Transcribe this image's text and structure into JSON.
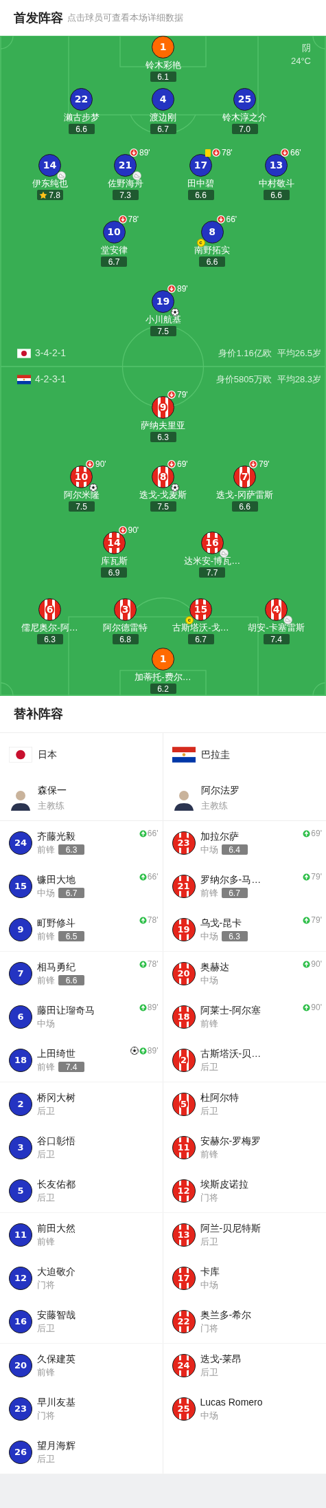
{
  "lineup": {
    "title": "首发阵容",
    "hint": "点击球员可查看本场详细数据",
    "weather": "阴",
    "temperature": "24°C",
    "home": {
      "kind": "japan",
      "rows": [
        [
          {
            "number": "1",
            "name": "铃木彩艳",
            "rating": "6.1",
            "kind": "keeper",
            "yellow_card": false,
            "goal": false,
            "assist": false,
            "best": false
          }
        ],
        [
          {
            "number": "22",
            "name": "濑古步梦",
            "rating": "6.6",
            "kind": "outfield",
            "yellow_card": false,
            "goal": false,
            "assist": false,
            "best": false
          },
          {
            "number": "4",
            "name": "渡边刚",
            "rating": "6.7",
            "kind": "outfield",
            "yellow_card": false,
            "goal": false,
            "assist": false,
            "best": false
          },
          {
            "number": "25",
            "name": "铃木淳之介",
            "rating": "7.0",
            "kind": "outfield",
            "yellow_card": false,
            "goal": false,
            "assist": false,
            "best": false
          }
        ],
        [
          {
            "number": "14",
            "name": "伊东纯也",
            "rating": "7.8",
            "kind": "outfield",
            "yellow_card": false,
            "goal": false,
            "assist": true,
            "best": true
          },
          {
            "number": "21",
            "name": "佐野海舟",
            "rating": "7.3",
            "kind": "outfield",
            "sub_off": "89'",
            "yellow_card": false,
            "goal": false,
            "assist": true,
            "best": false
          },
          {
            "number": "17",
            "name": "田中碧",
            "rating": "6.6",
            "kind": "outfield",
            "sub_off": "78'",
            "yellow_card": true,
            "goal": false,
            "assist": false,
            "best": false
          },
          {
            "number": "13",
            "name": "中村敬斗",
            "rating": "6.6",
            "kind": "outfield",
            "sub_off": "66'",
            "yellow_card": false,
            "goal": false,
            "assist": false,
            "best": false
          }
        ],
        [
          {
            "number": "10",
            "name": "堂安律",
            "rating": "6.7",
            "kind": "outfield",
            "sub_off": "78'",
            "yellow_card": false,
            "goal": false,
            "assist": false,
            "best": false
          },
          {
            "number": "8",
            "name": "南野拓实",
            "rating": "6.6",
            "kind": "outfield",
            "sub_off": "66'",
            "captain_mark": "c",
            "yellow_card": false,
            "goal": false,
            "assist": false,
            "best": false
          }
        ],
        [
          {
            "number": "19",
            "name": "小川航基",
            "rating": "7.5",
            "kind": "outfield",
            "sub_off": "89'",
            "yellow_card": false,
            "goal": true,
            "assist": false,
            "best": false
          }
        ]
      ]
    },
    "team_stats": [
      {
        "kind": "japan",
        "formation": "3-4-2-1",
        "value": "身价1.16亿欧",
        "average_age": "平均26.5岁"
      },
      {
        "kind": "paraguay",
        "formation": "4-2-3-1",
        "value": "身价5805万欧",
        "average_age": "平均28.3岁"
      }
    ],
    "away": {
      "kind": "paraguay",
      "rows": [
        [
          {
            "number": "9",
            "name": "萨纳夫里亚",
            "rating": "6.3",
            "kind": "outfield",
            "sub_off": "79'",
            "yellow_card": false,
            "goal": false,
            "assist": false,
            "best": false
          }
        ],
        [
          {
            "number": "10",
            "name": "阿尔米隆",
            "rating": "7.5",
            "kind": "outfield",
            "sub_off": "90'",
            "yellow_card": false,
            "goal": true,
            "assist": false,
            "best": false
          },
          {
            "number": "8",
            "name": "迭戈-戈麦斯",
            "rating": "7.5",
            "kind": "outfield",
            "sub_off": "69'",
            "yellow_card": false,
            "goal": true,
            "assist": false,
            "best": false
          },
          {
            "number": "7",
            "name": "迭戈-冈萨雷斯",
            "rating": "6.6",
            "kind": "outfield",
            "sub_off": "79'",
            "yellow_card": false,
            "goal": false,
            "assist": false,
            "best": false
          }
        ],
        [
          {
            "number": "14",
            "name": "库瓦斯",
            "rating": "6.9",
            "kind": "outfield",
            "sub_off": "90'",
            "yellow_card": false,
            "goal": false,
            "assist": false,
            "best": false
          },
          {
            "number": "16",
            "name": "达米安-博瓦…",
            "rating": "7.7",
            "kind": "outfield",
            "yellow_card": false,
            "goal": false,
            "assist": true,
            "best": false
          }
        ],
        [
          {
            "number": "6",
            "name": "儒尼奥尔-阿…",
            "rating": "6.3",
            "kind": "outfield",
            "yellow_card": false,
            "goal": false,
            "assist": false,
            "best": false
          },
          {
            "number": "3",
            "name": "阿尔德雷特",
            "rating": "6.8",
            "kind": "outfield",
            "yellow_card": false,
            "goal": false,
            "assist": false,
            "best": false
          },
          {
            "number": "15",
            "name": "古斯塔沃-戈…",
            "rating": "6.7",
            "kind": "outfield",
            "captain_mark": "c",
            "yellow_card": false,
            "goal": false,
            "assist": false,
            "best": false
          },
          {
            "number": "4",
            "name": "胡安-卡塞雷斯",
            "rating": "7.4",
            "kind": "outfield",
            "yellow_card": false,
            "goal": false,
            "assist": true,
            "best": false
          }
        ],
        [
          {
            "number": "1",
            "name": "加蒂托-费尔…",
            "rating": "6.2",
            "kind": "keeper",
            "yellow_card": false,
            "goal": false,
            "assist": false,
            "best": false
          }
        ]
      ]
    }
  },
  "substitutes": {
    "title": "替补阵容",
    "teams": [
      {
        "kind": "japan",
        "name": "日本",
        "coach": {
          "name": "森保一",
          "role": "主教练"
        },
        "players": [
          {
            "number": "24",
            "name": "齐藤光毅",
            "position": "前锋",
            "rating": "6.3",
            "sub_on": "66'",
            "goal": false
          },
          {
            "number": "15",
            "name": "镰田大地",
            "position": "中场",
            "rating": "6.7",
            "sub_on": "66'",
            "goal": false
          },
          {
            "number": "9",
            "name": "町野修斗",
            "position": "前锋",
            "rating": "6.5",
            "sub_on": "78'",
            "goal": false
          },
          {
            "number": "7",
            "name": "相马勇纪",
            "position": "前锋",
            "rating": "6.6",
            "sub_on": "78'",
            "goal": false
          },
          {
            "number": "6",
            "name": "藤田让瑠奇马",
            "position": "中场",
            "sub_on": "89'",
            "goal": false
          },
          {
            "number": "18",
            "name": "上田绮世",
            "position": "前锋",
            "rating": "7.4",
            "sub_on": "89'",
            "goal": true
          },
          {
            "number": "2",
            "name": "桥冈大树",
            "position": "后卫",
            "goal": false
          },
          {
            "number": "3",
            "name": "谷口彰悟",
            "position": "后卫",
            "goal": false
          },
          {
            "number": "5",
            "name": "长友佑都",
            "position": "后卫",
            "goal": false
          },
          {
            "number": "11",
            "name": "前田大然",
            "position": "前锋",
            "goal": false
          },
          {
            "number": "12",
            "name": "大迫敬介",
            "position": "门将",
            "goal": false
          },
          {
            "number": "16",
            "name": "安藤智哉",
            "position": "后卫",
            "goal": false
          },
          {
            "number": "20",
            "name": "久保建英",
            "position": "前锋",
            "goal": false
          },
          {
            "number": "23",
            "name": "早川友基",
            "position": "门将",
            "goal": false
          },
          {
            "number": "26",
            "name": "望月海辉",
            "position": "后卫",
            "goal": false
          }
        ]
      },
      {
        "kind": "paraguay",
        "name": "巴拉圭",
        "coach": {
          "name": "阿尔法罗",
          "role": "主教练"
        },
        "players": [
          {
            "number": "23",
            "name": "加拉尔萨",
            "position": "中场",
            "rating": "6.4",
            "sub_on": "69'",
            "goal": false
          },
          {
            "number": "21",
            "name": "罗纳尔多-马…",
            "position": "前锋",
            "rating": "6.7",
            "sub_on": "79'",
            "goal": false
          },
          {
            "number": "19",
            "name": "乌戈-昆卡",
            "position": "中场",
            "rating": "6.3",
            "sub_on": "79'",
            "goal": false
          },
          {
            "number": "20",
            "name": "奥赫达",
            "position": "中场",
            "sub_on": "90'",
            "goal": false
          },
          {
            "number": "18",
            "name": "阿莱士-阿尔塞",
            "position": "前锋",
            "sub_on": "90'",
            "goal": false
          },
          {
            "number": "2",
            "name": "古斯塔沃-贝…",
            "position": "后卫",
            "goal": false
          },
          {
            "number": "5",
            "name": "杜阿尔特",
            "position": "后卫",
            "goal": false
          },
          {
            "number": "11",
            "name": "安赫尔-罗梅罗",
            "position": "前锋",
            "goal": false
          },
          {
            "number": "12",
            "name": "埃斯皮诺拉",
            "position": "门将",
            "goal": false
          },
          {
            "number": "13",
            "name": "阿兰-贝尼特斯",
            "position": "后卫",
            "goal": false
          },
          {
            "number": "17",
            "name": "卡库",
            "position": "中场",
            "goal": false
          },
          {
            "number": "22",
            "name": "奥兰多-希尔",
            "position": "门将",
            "goal": false
          },
          {
            "number": "24",
            "name": "迭戈-莱昂",
            "position": "后卫",
            "goal": false
          },
          {
            "number": "25",
            "name": "Lucas Romero",
            "position": "中场",
            "goal": false
          }
        ]
      }
    ]
  }
}
